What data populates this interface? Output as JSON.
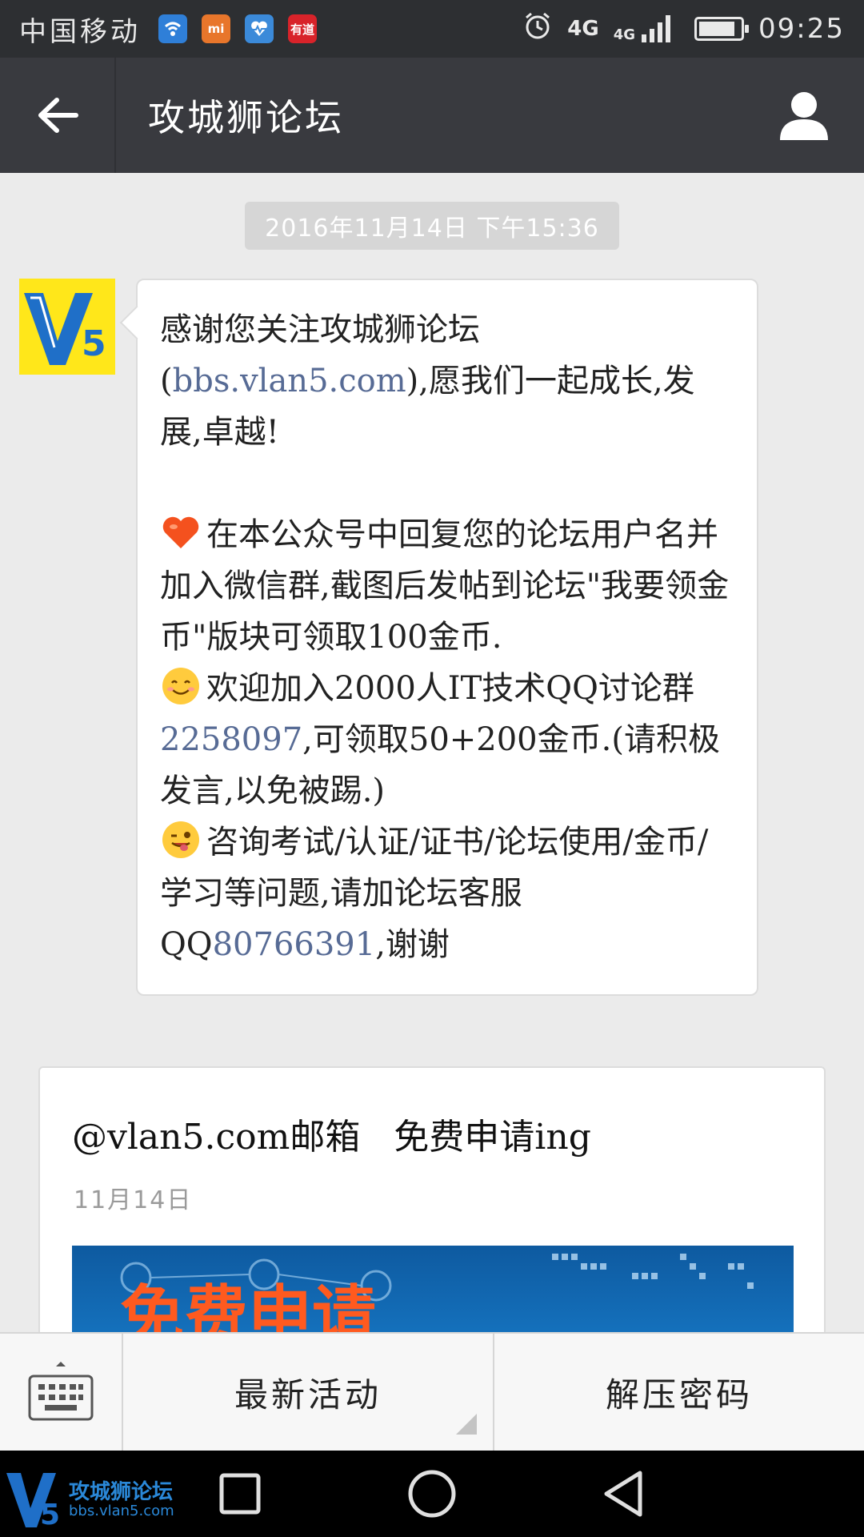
{
  "status_bar": {
    "carrier": "中国移动",
    "app_icons": [
      {
        "name": "wifi-app-icon",
        "color": "#2f7fd8"
      },
      {
        "name": "mi-icon",
        "color": "#e8762b",
        "text": "mi"
      },
      {
        "name": "health-icon",
        "color": "#3b8ad9"
      },
      {
        "name": "youdao-icon",
        "color": "#d8232a",
        "text": "有道"
      }
    ],
    "network_1": "4G",
    "network_2": "4G",
    "time": "09:25"
  },
  "header": {
    "title": "攻城狮论坛"
  },
  "chat": {
    "timestamp": "2016年11月14日 下午15:36",
    "message": {
      "line1": "感谢您关注攻城狮论坛",
      "open_paren": "(",
      "site_link": "bbs.vlan5.com",
      "line2_rest": "),愿我们一起成长,发展,卓越!",
      "p2": "在本公众号中回复您的论坛用户名并加入微信群,截图后发帖到论坛\"我要领金币\"版块可领取100金币.",
      "p3_a": "欢迎加入2000人IT技术QQ讨论群",
      "qq_group": "2258097",
      "p3_b": ",可领取50+200金币.(请积极发言,以免被踢.)",
      "p4_a": "咨询考试/认证/证书/论坛使用/金币/学习等问题,请加论坛客服QQ",
      "qq_service": "80766391",
      "p4_b": ",谢谢"
    }
  },
  "article_card": {
    "title": "@vlan5.com邮箱   免费申请ing",
    "date": "11月14日",
    "image_overlay_text": "免费申请"
  },
  "menu": {
    "items": [
      "最新活动",
      "解压密码"
    ]
  },
  "watermark": {
    "name": "攻城狮论坛",
    "url": "bbs.vlan5.com",
    "logo": "V5"
  },
  "colors": {
    "status_bar_bg": "#2d2f32",
    "title_bar_bg": "#393a3f",
    "chat_bg": "#ebebeb",
    "link": "#576b95"
  }
}
